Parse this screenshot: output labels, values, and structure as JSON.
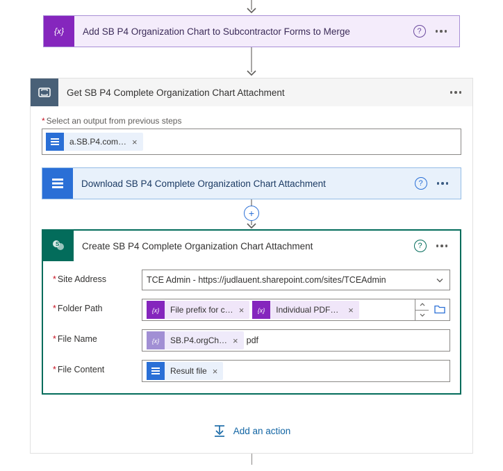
{
  "variable_step": {
    "title": "Add SB P4 Organization Chart to Subcontractor Forms to Merge"
  },
  "container": {
    "title": "Get SB P4 Complete Organization Chart Attachment",
    "select_output_label": "Select an output from previous steps",
    "output_token": "a.SB.P4.com…"
  },
  "download_step": {
    "title": "Download SB P4 Complete Organization Chart Attachment"
  },
  "create_step": {
    "title": "Create SB P4 Complete Organization Chart Attachment",
    "fields": {
      "site_address": {
        "label": "Site Address",
        "value": "TCE Admin - https://judlauent.sharepoint.com/sites/TCEAdmin"
      },
      "folder_path": {
        "label": "Folder Path",
        "tokens": [
          "File prefix for c…",
          "Individual PDFs…"
        ]
      },
      "file_name": {
        "label": "File Name",
        "token": "SB.P4.orgCh…",
        "suffix": "pdf"
      },
      "file_content": {
        "label": "File Content",
        "token": "Result file"
      }
    }
  },
  "add_action_label": "Add an action"
}
